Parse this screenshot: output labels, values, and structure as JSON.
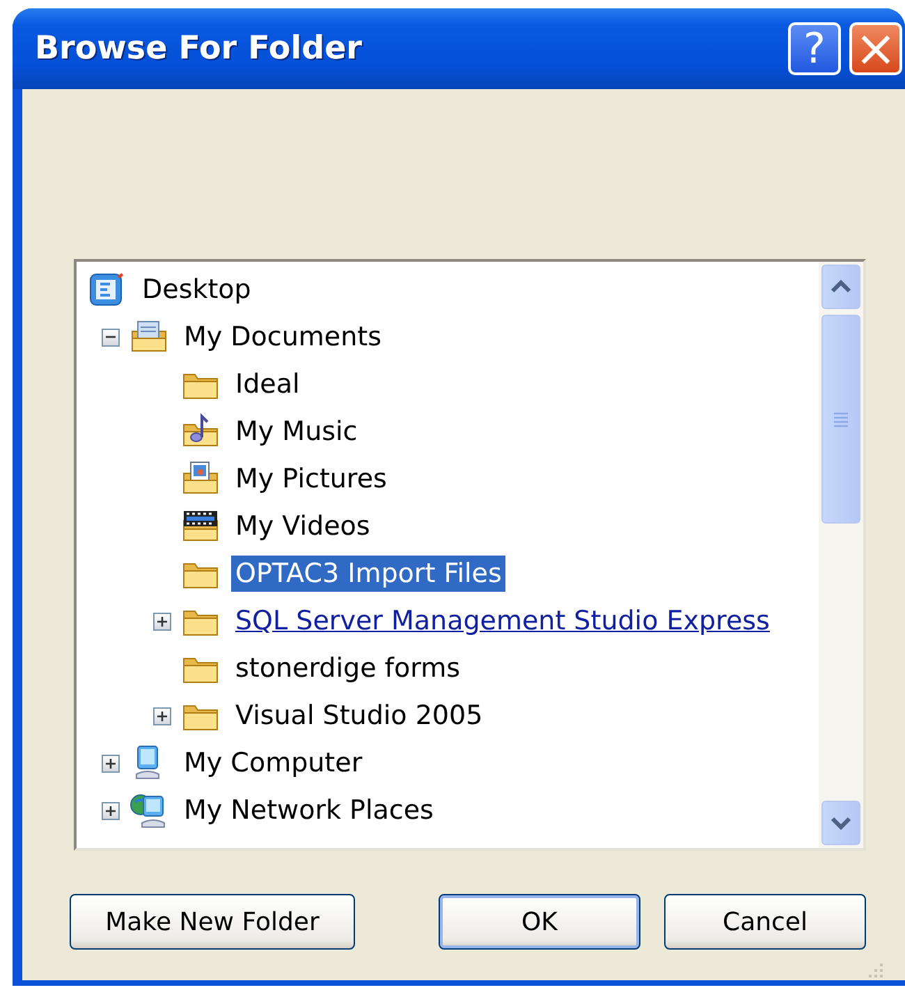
{
  "window": {
    "title": "Browse For Folder"
  },
  "title_buttons": [
    {
      "kind": "help",
      "label": "?"
    },
    {
      "kind": "close",
      "label": "×"
    }
  ],
  "tree": [
    {
      "label": "Desktop",
      "kind": "desktop",
      "selected": false,
      "hot": false,
      "children": [
        {
          "label": "My Documents",
          "kind": "documents",
          "expanded": true,
          "selected": false,
          "hot": false,
          "children": [
            {
              "label": "Ideal",
              "kind": "folder",
              "selected": false,
              "hot": false
            },
            {
              "label": "My Music",
              "kind": "music",
              "selected": false,
              "hot": false
            },
            {
              "label": "My Pictures",
              "kind": "pictures",
              "selected": false,
              "hot": false
            },
            {
              "label": "My Videos",
              "kind": "videos",
              "selected": false,
              "hot": false
            },
            {
              "label": "OPTAC3 Import Files",
              "kind": "folder",
              "selected": true,
              "hot": false
            },
            {
              "label": "SQL Server Management Studio Express",
              "kind": "folder",
              "expanded": false,
              "selected": false,
              "hot": true
            },
            {
              "label": "stonerdige forms",
              "kind": "folder",
              "selected": false,
              "hot": false
            },
            {
              "label": "Visual Studio 2005",
              "kind": "folder",
              "expanded": false,
              "selected": false,
              "hot": false
            }
          ]
        },
        {
          "label": "My Computer",
          "kind": "computer",
          "expanded": false,
          "selected": false,
          "hot": false
        },
        {
          "label": "My Network Places",
          "kind": "network",
          "expanded": false,
          "selected": false,
          "hot": false
        }
      ]
    }
  ],
  "buttons": [
    {
      "label": "Make New Folder",
      "default": false
    },
    {
      "label": "OK",
      "default": true
    },
    {
      "label": "Cancel",
      "default": false
    }
  ]
}
